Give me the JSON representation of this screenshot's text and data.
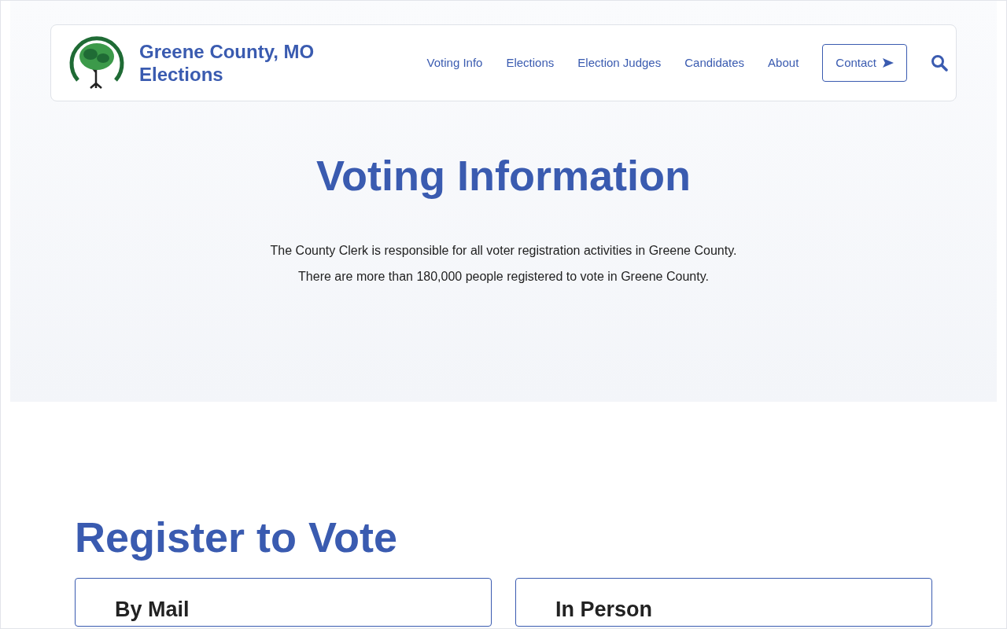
{
  "brand": {
    "name_line_1": "Greene County, MO",
    "name_line_2": "Elections"
  },
  "nav": {
    "links": [
      "Voting Info",
      "Elections",
      "Election Judges",
      "Candidates",
      "About"
    ],
    "contact_button": "Contact"
  },
  "hero": {
    "title": "Voting Information",
    "paragraphs": [
      "The County Clerk is responsible for all voter registration activities in Greene County.",
      "There are more than 180,000 people registered to vote in Greene County."
    ]
  },
  "register": {
    "title": "Register to Vote",
    "cards": [
      {
        "title": "By Mail"
      },
      {
        "title": "In Person"
      }
    ]
  }
}
